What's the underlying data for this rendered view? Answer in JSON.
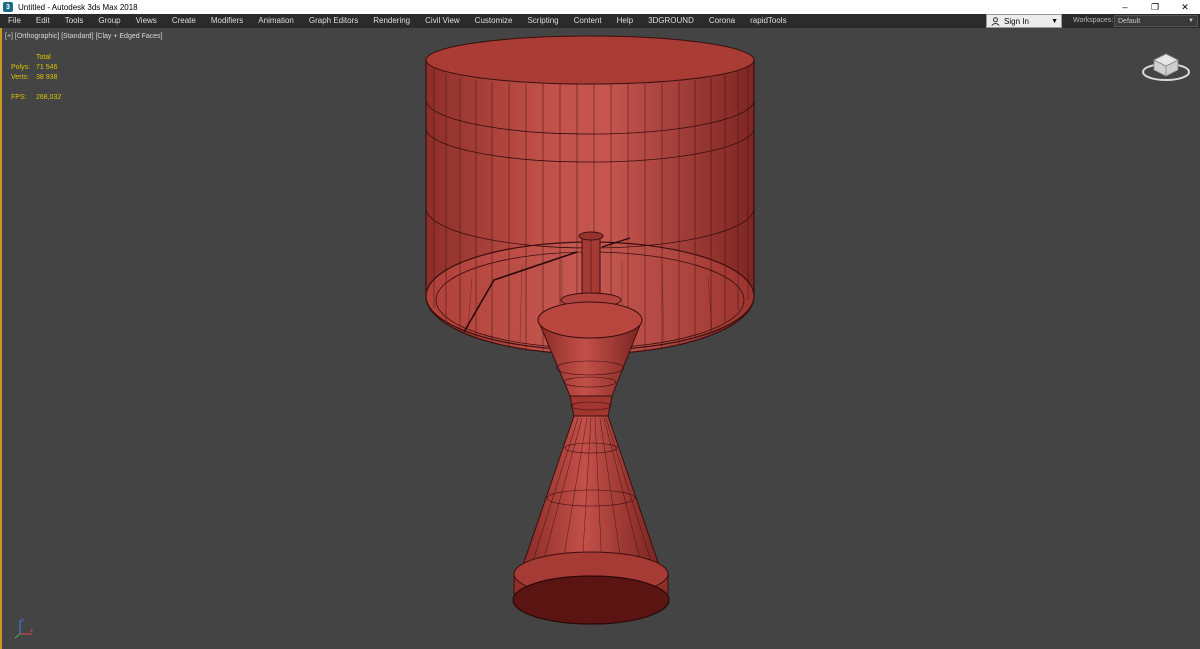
{
  "window": {
    "title": "Untitled - Autodesk 3ds Max 2018",
    "icon_letter": "3",
    "controls": [
      "–",
      "❐",
      "✕"
    ]
  },
  "menu": {
    "items": [
      "File",
      "Edit",
      "Tools",
      "Group",
      "Views",
      "Create",
      "Modifiers",
      "Animation",
      "Graph Editors",
      "Rendering",
      "Civil View",
      "Customize",
      "Scripting",
      "Content",
      "Help",
      "3DGROUND",
      "Corona",
      "rapidTools"
    ]
  },
  "account": {
    "signin_label": "Sign In",
    "workspaces_label": "Workspaces:",
    "workspace_value": "Default"
  },
  "viewport": {
    "label": "[+] [Orthographic] [Standard] [Clay + Edged Faces]",
    "stats": {
      "header": "Total",
      "polys_label": "Polys:",
      "polys_value": "71 546",
      "verts_label": "Verts:",
      "verts_value": "38 938",
      "fps_label": "FPS:",
      "fps_value": "268,032"
    },
    "model": "lamp",
    "colors": {
      "background": "#444444",
      "clay": "#b8463f",
      "clay_dark": "#8a2c28",
      "edges": "#3a0f0e",
      "viewport_border": "#c79a25",
      "stats_text": "#d9c400"
    }
  }
}
